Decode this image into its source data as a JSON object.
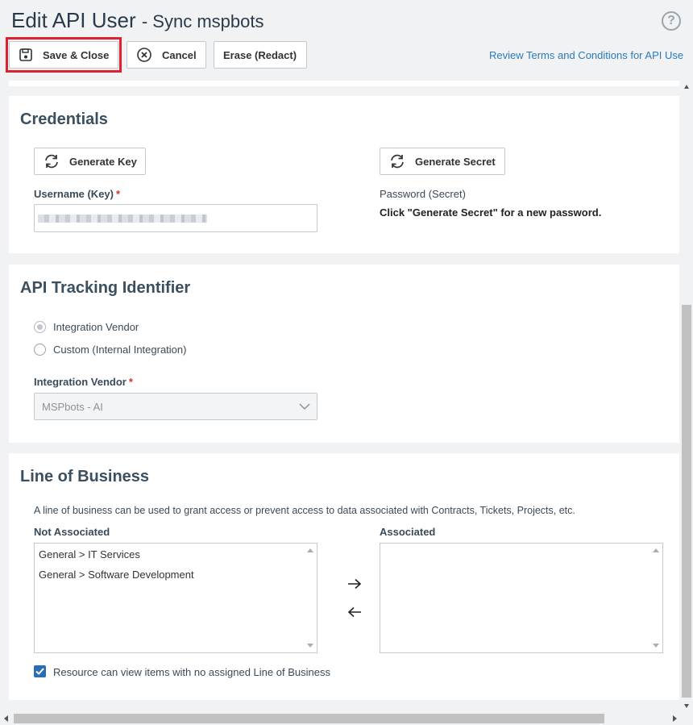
{
  "header": {
    "title": "Edit API User",
    "subtitle": "- Sync mspbots",
    "terms_link": "Review Terms and Conditions for API Use"
  },
  "toolbar": {
    "save_close_label": "Save & Close",
    "cancel_label": "Cancel",
    "erase_label": "Erase (Redact)"
  },
  "credentials": {
    "title": "Credentials",
    "generate_key_label": "Generate Key",
    "generate_secret_label": "Generate Secret",
    "username_label": "Username (Key)",
    "password_label": "Password (Secret)",
    "password_hint": "Click \"Generate Secret\" for a new password."
  },
  "tracking": {
    "title": "API Tracking Identifier",
    "options": [
      {
        "label": "Integration Vendor",
        "selected": true
      },
      {
        "label": "Custom (Internal Integration)",
        "selected": false
      }
    ],
    "vendor_label": "Integration Vendor",
    "vendor_value": "MSPbots - AI"
  },
  "lob": {
    "title": "Line of Business",
    "description": "A line of business can be used to grant access or prevent access to data associated with Contracts, Tickets, Projects, etc.",
    "not_associated_label": "Not Associated",
    "associated_label": "Associated",
    "not_associated_items": [
      "General > IT Services",
      "General > Software Development"
    ],
    "associated_items": [],
    "checkbox_label": "Resource can view items with no assigned Line of Business",
    "checkbox_checked": true
  },
  "colors": {
    "highlight": "#e0212f",
    "link": "#2a7ab8",
    "required": "#d0342c",
    "checkbox": "#2a6fb5"
  }
}
